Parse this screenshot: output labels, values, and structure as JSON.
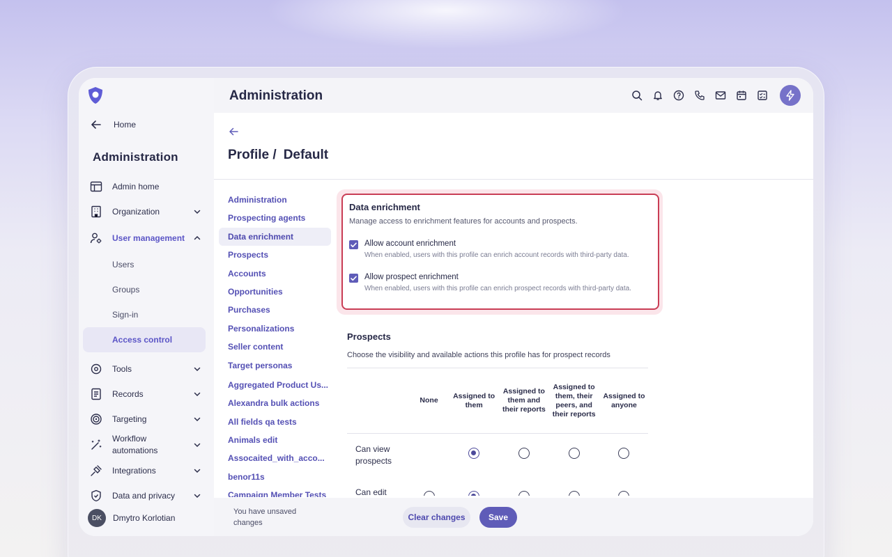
{
  "app": {
    "title": "Administration"
  },
  "sidebar": {
    "home_label": "Home",
    "title": "Administration",
    "items": [
      {
        "label": "Admin home"
      },
      {
        "label": "Organization"
      },
      {
        "label": "User management"
      },
      {
        "label": "Tools"
      },
      {
        "label": "Records"
      },
      {
        "label": "Targeting"
      },
      {
        "label": "Workflow automations"
      },
      {
        "label": "Integrations"
      },
      {
        "label": "Data and privacy"
      }
    ],
    "user_management_sub": [
      "Users",
      "Groups",
      "Sign-in",
      "Access control"
    ],
    "user": {
      "initials": "DK",
      "name": "Dmytro Korlotian"
    }
  },
  "page": {
    "title_prefix": "Profile /",
    "title_name": "Default"
  },
  "subnav": [
    "Administration",
    "Prospecting agents",
    "Data enrichment",
    "Prospects",
    "Accounts",
    "Opportunities",
    "Purchases",
    "Personalizations",
    "Seller content",
    "Target personas",
    "Aggregated Product Us...",
    "Alexandra bulk actions",
    "All fields qa tests",
    "Animals edit",
    "Assocaited_with_acco...",
    "benor11s",
    "Campaign Member Tests"
  ],
  "enrichment": {
    "title": "Data enrichment",
    "description": "Manage access to enrichment features for accounts and prospects.",
    "options": [
      {
        "label": "Allow account enrichment",
        "help": "When enabled, users with this profile can enrich account records with third-party data.",
        "checked": true
      },
      {
        "label": "Allow prospect enrichment",
        "help": "When enabled, users with this profile can enrich prospect records with third-party data.",
        "checked": true
      }
    ]
  },
  "prospects": {
    "title": "Prospects",
    "description": "Choose the visibility and available actions this profile has for prospect records",
    "columns": [
      "None",
      "Assigned to them",
      "Assigned to them and their reports",
      "Assigned to them, their peers, and their reports",
      "Assigned to anyone"
    ],
    "rows": [
      {
        "label": "Can view prospects",
        "selected": 1,
        "has_none": false
      },
      {
        "label": "Can edit prospects",
        "selected": 1,
        "has_none": true
      }
    ]
  },
  "footer": {
    "unsaved": "You have unsaved changes",
    "clear_label": "Clear changes",
    "save_label": "Save"
  },
  "colors": {
    "accent": "#5f5cb8",
    "highlight_border": "#c93d55"
  }
}
